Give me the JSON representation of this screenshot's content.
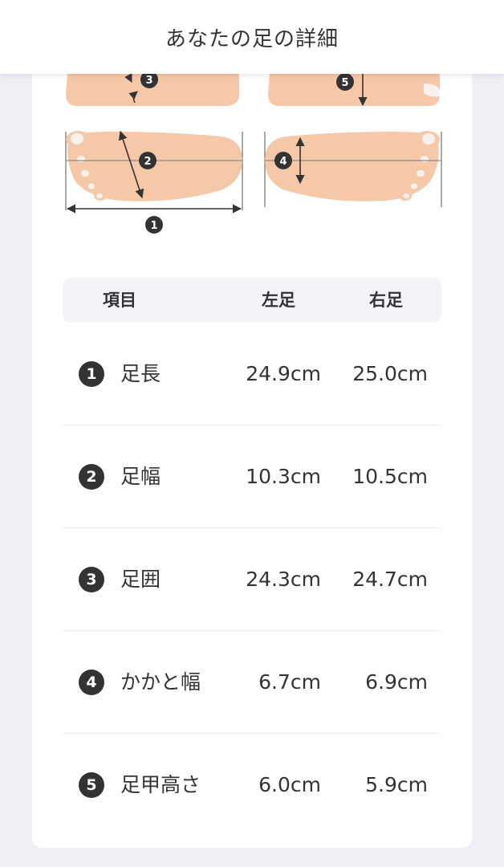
{
  "header": {
    "title": "あなたの足の詳細"
  },
  "diagram": {
    "markers": [
      "1",
      "2",
      "3",
      "4",
      "5"
    ]
  },
  "table": {
    "headers": {
      "item": "項目",
      "left": "左足",
      "right": "右足"
    },
    "rows": [
      {
        "number": "1",
        "label": "足長",
        "left": "24.9cm",
        "right": "25.0cm"
      },
      {
        "number": "2",
        "label": "足幅",
        "left": "10.3cm",
        "right": "10.5cm"
      },
      {
        "number": "3",
        "label": "足囲",
        "left": "24.3cm",
        "right": "24.7cm"
      },
      {
        "number": "4",
        "label": "かかと幅",
        "left": "6.7cm",
        "right": "6.9cm"
      },
      {
        "number": "5",
        "label": "足甲高さ",
        "left": "6.0cm",
        "right": "5.9cm"
      }
    ]
  },
  "colors": {
    "skin": "#f5c8a8",
    "nail": "#f7f2ee",
    "badge": "#333333",
    "page_background": "#eef0f5",
    "table_header_background": "#f2f4f8"
  }
}
